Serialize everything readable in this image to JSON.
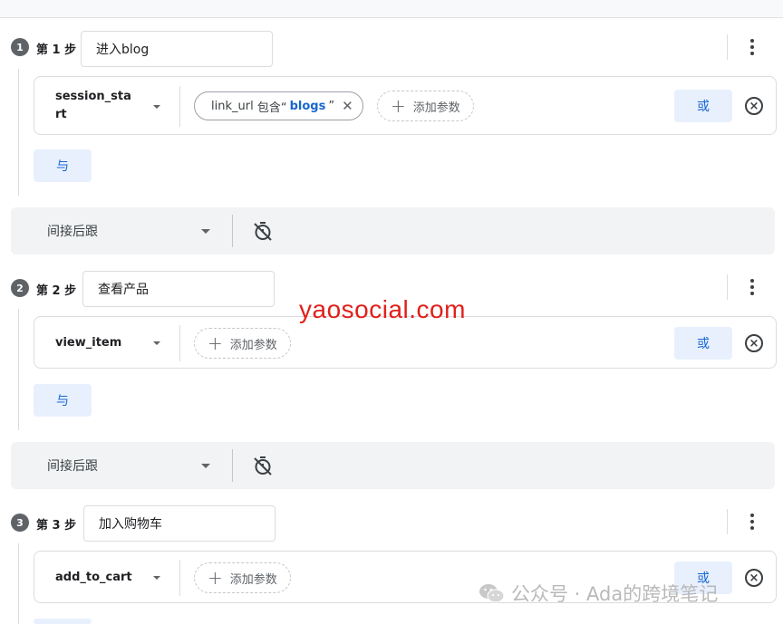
{
  "steps": [
    {
      "number": "1",
      "label": "第 1 步",
      "name_value": "进入blog",
      "event_name": "session_start",
      "condition": {
        "param": "link_url",
        "operator": "包含“",
        "value": "blogs",
        "suffix": " ”",
        "remove_icon": "close-icon"
      },
      "add_param_label": "添加参数",
      "or_label": "或",
      "and_label": "与"
    },
    {
      "number": "2",
      "label": "第 2 步",
      "name_value": "查看产品",
      "event_name": "view_item",
      "add_param_label": "添加参数",
      "or_label": "或",
      "and_label": "与"
    },
    {
      "number": "3",
      "label": "第 3 步",
      "name_value": "加入购物车",
      "event_name": "add_to_cart",
      "add_param_label": "添加参数",
      "or_label": "或"
    }
  ],
  "sequence_bars": [
    {
      "label": "间接后跟",
      "icon": "timer-off-icon"
    },
    {
      "label": "间接后跟",
      "icon": "timer-off-icon"
    }
  ],
  "watermarks": {
    "site": "yaosocial.com",
    "wechat": "公众号 · Ada的跨境笔记"
  },
  "colors": {
    "accent": "#1967d2",
    "accent_bg": "#e8f0fe",
    "watermark_red": "#e0201b"
  }
}
